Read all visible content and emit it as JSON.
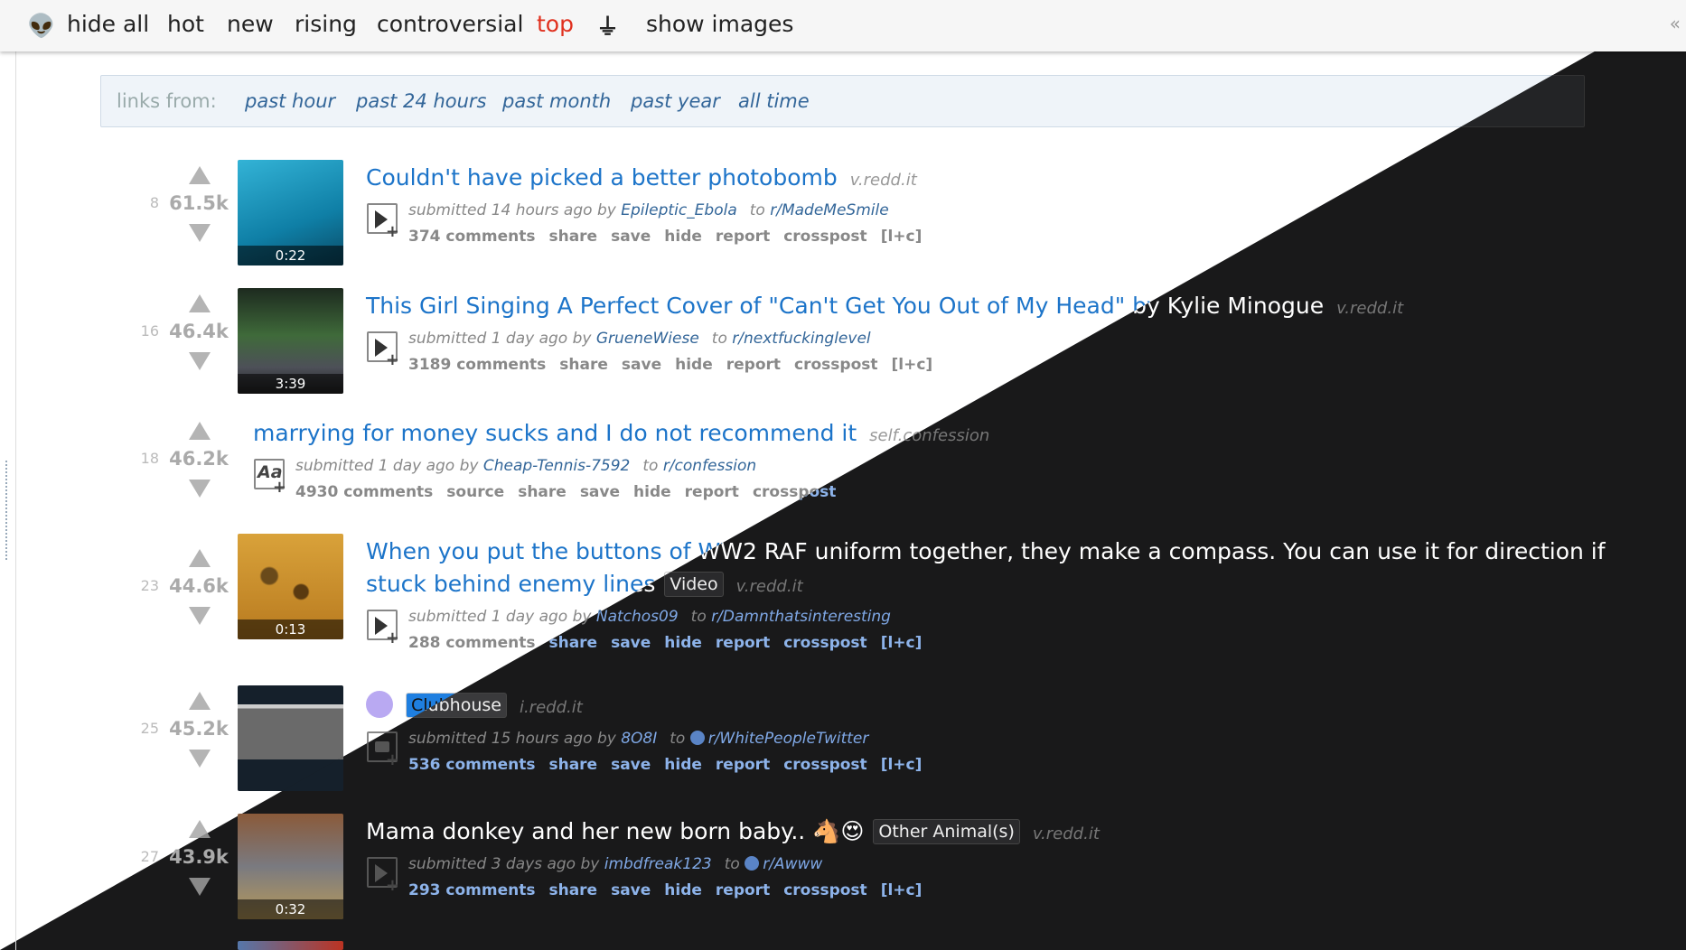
{
  "header": {
    "items": [
      "hide all",
      "hot",
      "new",
      "rising",
      "controversial",
      "top"
    ],
    "selected": "top",
    "show_images": "show images",
    "collapse": "«"
  },
  "time_filter": {
    "label": "links from:",
    "options": [
      "past hour",
      "past 24 hours",
      "past month",
      "past year",
      "all time"
    ]
  },
  "colors": {
    "accent": "#1c74c9",
    "selected_sort": "#e0301e",
    "dark_bg": "#19191a"
  },
  "posts": [
    {
      "rank": "8",
      "score": "61.5k",
      "title": "Couldn't have picked a better photobomb",
      "domain": "v.redd.it",
      "age": "submitted 14 hours ago by",
      "author": "Epileptic_Ebola",
      "to": "to",
      "subreddit": "r/MadeMeSmile",
      "comments": "374 comments",
      "actions": [
        "share",
        "save",
        "hide",
        "report",
        "crosspost",
        "[l+c]"
      ],
      "duration": "0:22",
      "thumb": "linear-gradient(160deg,#33b3d6,#0f7fa6 60%,#0a4b66)",
      "expando": "video"
    },
    {
      "rank": "16",
      "score": "46.4k",
      "title": "This Girl Singing A Perfect Cover of \"Can't Get You Out of My Head\" by Kylie Minogue",
      "domain": "v.redd.it",
      "age": "submitted 1 day ago by",
      "author": "GrueneWiese",
      "to": "to",
      "subreddit": "r/nextfuckinglevel",
      "comments": "3189 comments",
      "actions": [
        "share",
        "save",
        "hide",
        "report",
        "crosspost",
        "[l+c]"
      ],
      "duration": "3:39",
      "thumb": "linear-gradient(180deg,#1d2a1f,#3f6a3a 45%,#4d5058 75%,#222)",
      "expando": "video"
    },
    {
      "rank": "18",
      "score": "46.2k",
      "title": "marrying for money sucks and I do not recommend it",
      "domain": "self.confession",
      "age": "submitted 1 day ago by",
      "author": "Cheap-Tennis-7592",
      "to": "to",
      "subreddit": "r/confession",
      "comments": "4930 comments",
      "actions": [
        "source",
        "share",
        "save",
        "hide",
        "report",
        "crosspost"
      ],
      "expando": "text"
    },
    {
      "rank": "23",
      "score": "44.6k",
      "title": "When you put the buttons of WW2 RAF uniform together, they make a compass. You can use it for direction if",
      "title2": "stuck behind enemy lines",
      "flair": "Video",
      "domain": "v.redd.it",
      "age": "submitted 1 day ago by",
      "author": "Natchos09",
      "to": "to",
      "subreddit": "r/Damnthatsinteresting",
      "comments": "288 comments",
      "actions": [
        "share",
        "save",
        "hide",
        "report",
        "crosspost",
        "[l+c]"
      ],
      "duration": "0:13",
      "thumb": "radial-gradient(circle at 30% 40%,#6a4a1a 8%,transparent 10%),radial-gradient(circle at 60% 55%,#5a3a10 8%,transparent 10%),linear-gradient(180deg,#d9a23a,#b87a1f)",
      "expando": "video"
    },
    {
      "rank": "25",
      "score": "45.2k",
      "flair": "Clubhouse",
      "domain": "i.redd.it",
      "age": "submitted 15 hours ago by",
      "author": "8O8I",
      "to": "to",
      "subreddit": "r/WhitePeopleTwitter",
      "comments": "536 comments",
      "actions": [
        "share",
        "save",
        "hide",
        "report",
        "crosspost",
        "[l+c]"
      ],
      "thumb": "linear-gradient(180deg,#15202b 0 18%,#ccc 18% 22%,#6a6a6a 22% 70%,#15202b 70%)",
      "expando": "image"
    },
    {
      "rank": "27",
      "score": "43.9k",
      "title": "Mama donkey and her new born baby.. 🐴😍",
      "flair": "Other Animal(s)",
      "domain": "v.redd.it",
      "age": "submitted 3 days ago by",
      "author": "imbdfreak123",
      "to": "to",
      "subreddit": "r/Awww",
      "comments": "293 comments",
      "actions": [
        "share",
        "save",
        "hide",
        "report",
        "crosspost",
        "[l+c]"
      ],
      "duration": "0:32",
      "thumb": "linear-gradient(180deg,#8a5a3a,#7a7a80 50%,#b89a5a)",
      "expando": "video"
    }
  ]
}
